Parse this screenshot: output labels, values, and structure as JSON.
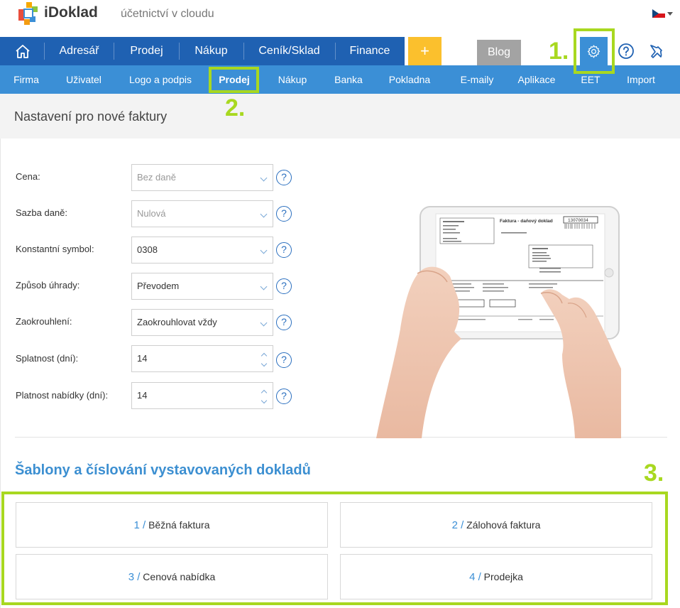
{
  "app": {
    "logo_text": "iDoklad",
    "slogan": "účetnictví v cloudu",
    "language_flag": "czech-flag"
  },
  "main_nav": {
    "home_icon": "home-icon",
    "items": [
      "Adresář",
      "Prodej",
      "Nákup",
      "Ceník/Sklad",
      "Finance"
    ],
    "plus_label": "+",
    "blog_label": "Blog"
  },
  "sub_nav": {
    "items": [
      "Firma",
      "Uživatel",
      "Logo a podpis",
      "Prodej",
      "Nákup",
      "Banka",
      "Pokladna",
      "E-maily",
      "Aplikace",
      "EET",
      "Import"
    ],
    "active": "Prodej"
  },
  "annotations": {
    "one": "1.",
    "two": "2.",
    "three": "3."
  },
  "section": {
    "title": "Nastavení pro nové faktury"
  },
  "form": {
    "price_label": "Cena:",
    "price_value": "Bez daně",
    "vat_label": "Sazba daně:",
    "vat_value": "Nulová",
    "const_label": "Konstantní symbol:",
    "const_value": "0308",
    "payment_label": "Způsob úhrady:",
    "payment_value": "Převodem",
    "round_label": "Zaokrouhlení:",
    "round_value": "Zaokrouhlovat vždy",
    "due_label": "Splatnost (dní):",
    "due_value": "14",
    "offer_label": "Platnost nabídky (dní):",
    "offer_value": "14",
    "help": "?"
  },
  "templates": {
    "title": "Šablony a číslování vystavovaných dokladů",
    "items": [
      {
        "num": "1 /",
        "label": "Běžná faktura"
      },
      {
        "num": "2 /",
        "label": "Zálohová faktura"
      },
      {
        "num": "3 /",
        "label": "Cenová nabídka"
      },
      {
        "num": "4 /",
        "label": "Prodejka"
      }
    ]
  },
  "illustration": {
    "invoice_title": "Faktura - daňový doklad",
    "invoice_number": "13070034"
  },
  "colors": {
    "nav": "#1f61b2",
    "subnav": "#3b8fd6",
    "highlight": "#a8d820",
    "plus": "#fbc02d"
  }
}
